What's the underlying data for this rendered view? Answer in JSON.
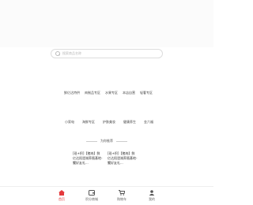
{
  "search": {
    "placeholder": "搜索商品名称"
  },
  "categories_row1": [
    "鲜亿达特供",
    "肉制品专区",
    "水果专区",
    "本店自营",
    "轻奢专区"
  ],
  "categories_row2": [
    "小家电",
    "海鲜专区",
    "护肤美妆",
    "健康养生",
    "金六福"
  ],
  "recommend": {
    "title": "为你推荐"
  },
  "products": [
    {
      "title": "[现+积]【猪肉】鲜亿达阳澄湖养殖基地-蟹好友礼..."
    },
    {
      "title": "[现+积]【猪肉】鲜亿达阳澄湖养殖基地-蟹好友礼..."
    }
  ],
  "tabbar": {
    "items": [
      {
        "label": "首页",
        "icon": "home-icon"
      },
      {
        "label": "积分商城",
        "icon": "card-icon"
      },
      {
        "label": "购物车",
        "icon": "cart-icon"
      },
      {
        "label": "我的",
        "icon": "user-icon"
      }
    ],
    "active_color": "#e4393c",
    "inactive_color": "#666666"
  }
}
